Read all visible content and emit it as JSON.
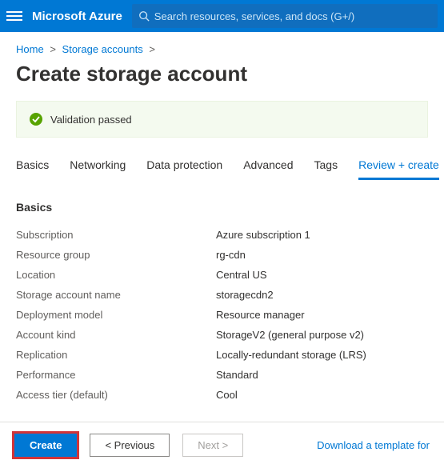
{
  "brand": "Microsoft Azure",
  "search": {
    "placeholder": "Search resources, services, and docs (G+/)"
  },
  "breadcrumbs": {
    "home": "Home",
    "storage": "Storage accounts"
  },
  "title": "Create storage account",
  "validation": {
    "text": "Validation passed"
  },
  "tabs": {
    "basics": "Basics",
    "networking": "Networking",
    "dataprotection": "Data protection",
    "advanced": "Advanced",
    "tags": "Tags",
    "reviewcreate": "Review + create"
  },
  "section": {
    "title": "Basics"
  },
  "kv": {
    "subscription_k": "Subscription",
    "subscription_v": "Azure subscription 1",
    "rg_k": "Resource group",
    "rg_v": "rg-cdn",
    "location_k": "Location",
    "location_v": "Central US",
    "san_k": "Storage account name",
    "san_v": "storagecdn2",
    "dm_k": "Deployment model",
    "dm_v": "Resource manager",
    "ak_k": "Account kind",
    "ak_v": "StorageV2 (general purpose v2)",
    "rep_k": "Replication",
    "rep_v": "Locally-redundant storage (LRS)",
    "perf_k": "Performance",
    "perf_v": "Standard",
    "at_k": "Access tier (default)",
    "at_v": "Cool"
  },
  "footer": {
    "create": "Create",
    "previous": "< Previous",
    "next": "Next >",
    "download": "Download a template for"
  }
}
